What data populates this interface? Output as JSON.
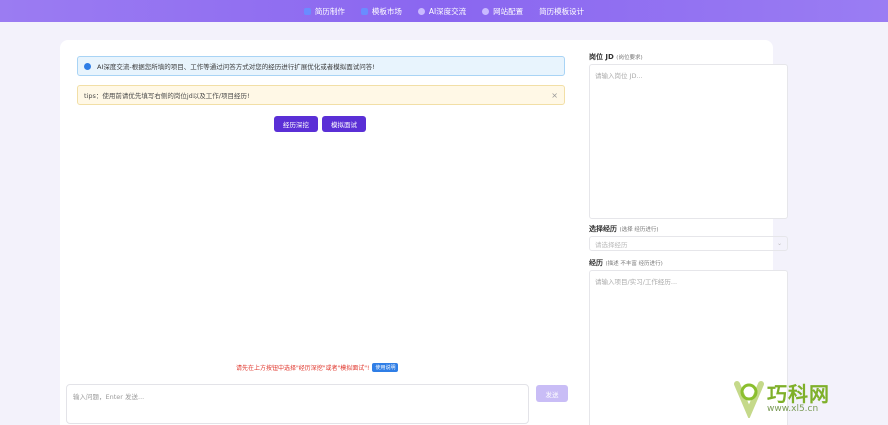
{
  "nav": {
    "items": [
      {
        "label": "简历制作",
        "icon": "document-icon"
      },
      {
        "label": "模板市场",
        "icon": "template-icon"
      },
      {
        "label": "AI深度交流",
        "icon": "ai-icon"
      },
      {
        "label": "网站配置",
        "icon": "config-icon"
      },
      {
        "label": "简历模板设计",
        "icon": "none"
      }
    ]
  },
  "main": {
    "info_alert": "AI深度交流-根据您所填的项目、工作等通过问答方式对您的经历进行扩展优化或者模拟面试问答!",
    "tip_alert": "tips：使用前请优先填写右侧的岗位jd以及工作/项目经历!",
    "close_glyph": "×",
    "btn_deep": "经历深挖",
    "btn_mock": "模拟面试",
    "hint": "请先在上方按钮中选择\"经历深挖\"或者\"模拟面试\"!",
    "hint_badge": "使用说明",
    "chat_placeholder": "输入问题，Enter 发送...",
    "send_label": "发送"
  },
  "side": {
    "jd_label": "岗位 JD",
    "jd_sub": "(岗位要求)",
    "jd_placeholder": "请输入岗位 JD...",
    "exp_select_label": "选择经历",
    "exp_select_sub": "(选择    经历进行)",
    "exp_select_placeholder": "请选择经历",
    "exp_label": "经历",
    "exp_sub": "(描述    不丰富    经历进行)",
    "exp_placeholder": "请输入项目/实习/工作经历..."
  },
  "watermark": {
    "text": "巧科网",
    "url": "www.xl5.cn"
  },
  "colors": {
    "nav": "#8a66f0",
    "primary": "#5a2fd6",
    "hint": "#e0352b"
  }
}
